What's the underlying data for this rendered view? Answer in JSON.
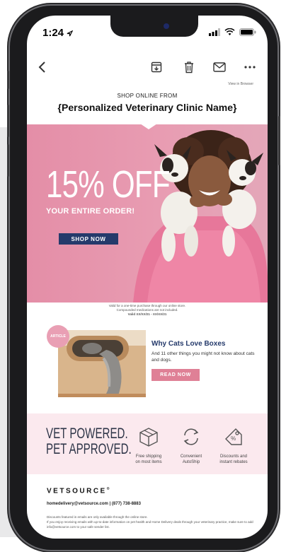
{
  "status_bar": {
    "time": "1:24"
  },
  "email": {
    "view_in_browser": "View in Browser",
    "shop_online": "SHOP ONLINE FROM",
    "clinic_name": "{Personalized Veterinary Clinic Name}",
    "hero": {
      "discount": "15% OFF",
      "subtitle": "YOUR ENTIRE ORDER!",
      "button": "SHOP NOW"
    },
    "fine_print": [
      "Valid for a one-time purchase through our online store.",
      "Compounded medications are not included.",
      "Valid XX/XX/21 - XX/XX/21"
    ],
    "article": {
      "badge": "ARTICLE",
      "title": "Why Cats Love Boxes",
      "text": "And 11 other things you might not know about cats and dogs.",
      "button": "READ NOW"
    },
    "vet_panel": {
      "line1": "VET POWERED.",
      "line2": "PET APPROVED.",
      "features": [
        {
          "icon": "box-icon",
          "label1": "Free shipping",
          "label2": "on most items"
        },
        {
          "icon": "autoship-icon",
          "label1": "Convenient",
          "label2": "AutoShip"
        },
        {
          "icon": "tag-icon",
          "label1": "Discounts and",
          "label2": "instant rebates"
        }
      ]
    },
    "footer": {
      "brand": "VETSOURCE",
      "contact": "homedelivery@vetsource.com | (877) 738-8883",
      "disclaimer1": "Discounts featured in emails are only available through the online store.",
      "disclaimer2": "If you enjoy receiving emails with up-to-date information on pet health and Home Delivery deals through your veterinary practice, make sure to add info@vetsource.com to your safe sender list."
    }
  },
  "colors": {
    "hero_pink": "#e48ea7",
    "navy": "#253a6b",
    "read_pink": "#df8096",
    "panel_bg": "#fbe9ee"
  }
}
